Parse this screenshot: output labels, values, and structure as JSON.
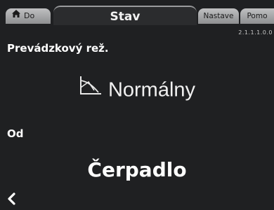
{
  "tabs": {
    "home": {
      "label": "Do",
      "icon": "home-icon"
    },
    "active": {
      "label": "Stav"
    },
    "settings": {
      "label": "Nastave"
    },
    "help": {
      "label": "Pomo"
    }
  },
  "menu_code": "2.1.1.1.0.0",
  "operating_mode": {
    "label": "Prevádzkový rež.",
    "value": "Normálny",
    "icon": "pump-curve-icon"
  },
  "source": {
    "label": "Od",
    "value": "Čerpadlo"
  },
  "navigation": {
    "back_icon": "chevron-left-icon"
  },
  "colors": {
    "background": "#1f2022",
    "tab_inactive": "#a8a9ab",
    "text": "#ffffff"
  }
}
